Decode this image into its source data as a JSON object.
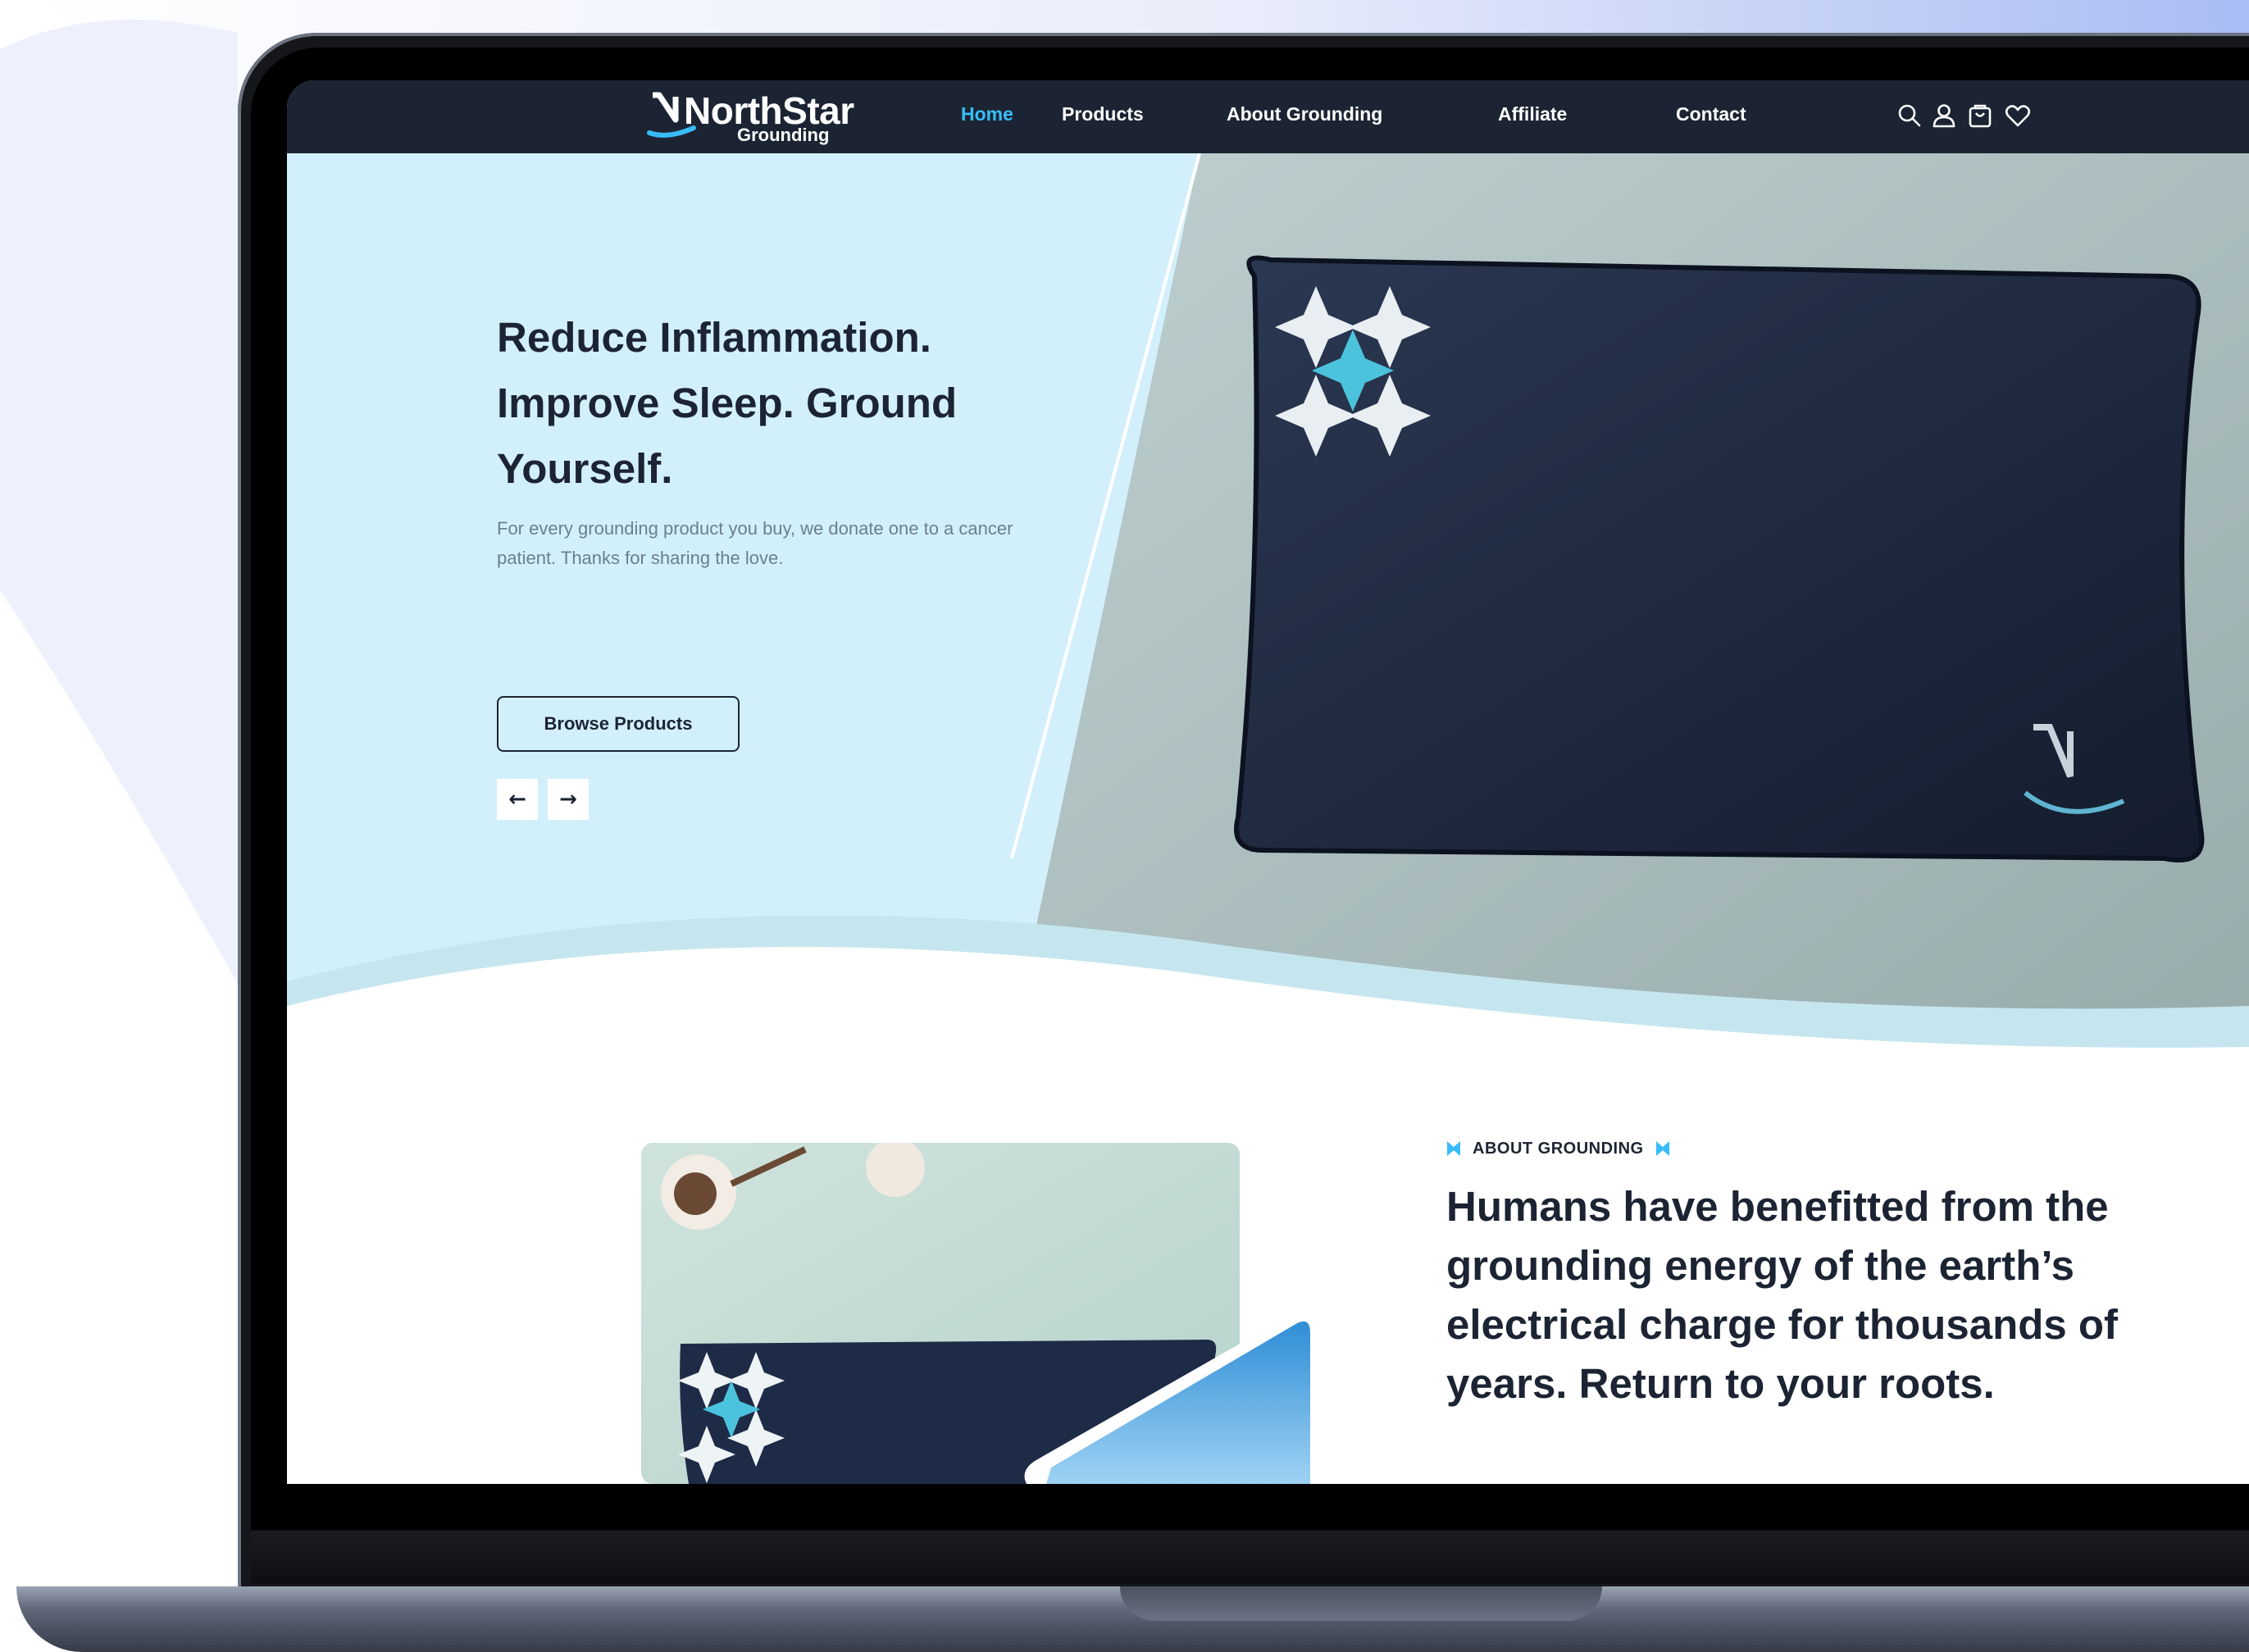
{
  "colors": {
    "nav_bg": "#1c2433",
    "accent": "#38bdf8",
    "hero_bg": "#d2f0fb",
    "text_dark": "#1c2433",
    "text_muted": "#6b7f8e"
  },
  "brand": {
    "name": "NorthStar",
    "tagline": "Grounding"
  },
  "nav": {
    "links": [
      "Home",
      "Products",
      "About Grounding",
      "Affiliate",
      "Contact"
    ],
    "active": "Home",
    "icons": [
      "search-icon",
      "user-icon",
      "cart-icon",
      "heart-icon"
    ]
  },
  "hero": {
    "headline": "Reduce Inflammation. Improve Sleep. Ground Yourself.",
    "subtext": "For every grounding product you buy, we donate one to a cancer patient. Thanks for sharing the love.",
    "cta_label": "Browse Products",
    "prev_label": "←",
    "next_label": "→"
  },
  "about": {
    "eyebrow": "ABOUT GROUNDING",
    "heading": "Humans have benefitted from the grounding energy of the earth’s electrical charge for thousands of years. Return to your roots."
  }
}
